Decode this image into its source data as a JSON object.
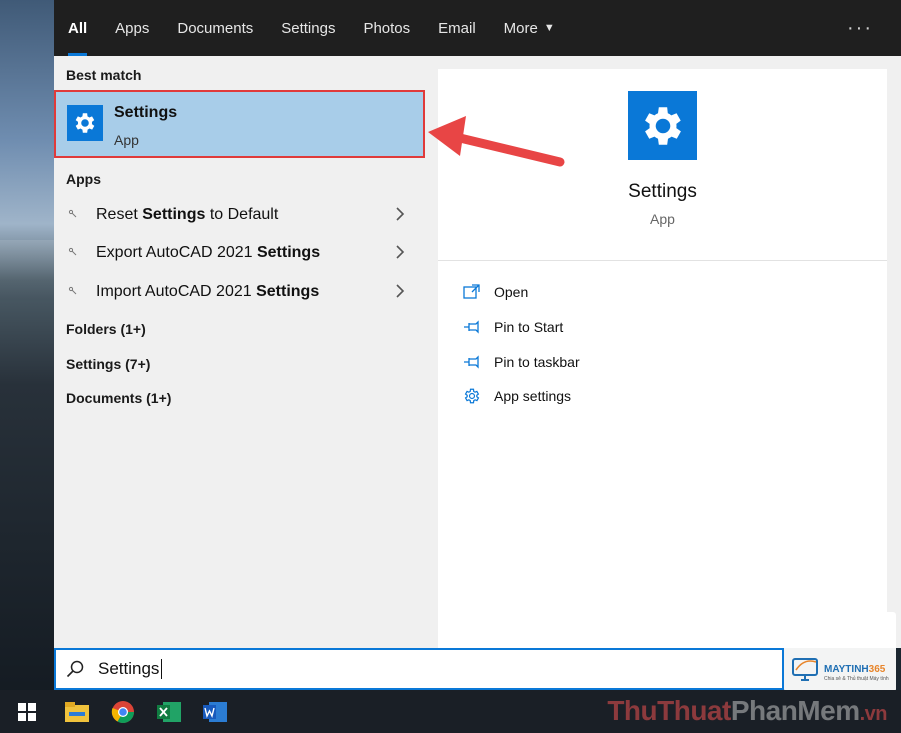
{
  "topnav": {
    "tabs": [
      "All",
      "Apps",
      "Documents",
      "Settings",
      "Photos",
      "Email",
      "More"
    ],
    "active": "All",
    "more_caret": "▼",
    "overflow": "···"
  },
  "results": {
    "best_match_header": "Best match",
    "best_match": {
      "title": "Settings",
      "subtitle": "App"
    },
    "apps_header": "Apps",
    "apps": [
      {
        "pre": "Reset ",
        "bold": "Settings",
        "post": " to Default"
      },
      {
        "pre": "Export AutoCAD 2021 ",
        "bold": "Settings",
        "post": ""
      },
      {
        "pre": "Import AutoCAD 2021 ",
        "bold": "Settings",
        "post": ""
      }
    ],
    "groups": [
      "Folders (1+)",
      "Settings (7+)",
      "Documents (1+)"
    ]
  },
  "detail": {
    "title": "Settings",
    "subtitle": "App",
    "actions": [
      "Open",
      "Pin to Start",
      "Pin to taskbar",
      "App settings"
    ]
  },
  "search": {
    "value": "Settings"
  },
  "logo": {
    "name_a": "MAYTINH",
    "name_b": "365",
    "tagline": "Chia sẻ & Thủ thuật Máy tính"
  },
  "watermark": {
    "a": "ThuThuat",
    "b": "PhanMem",
    "c": ".vn"
  },
  "colors": {
    "accent": "#0a78d7",
    "highlight": "#a8cde9",
    "arrow": "#e84545"
  }
}
